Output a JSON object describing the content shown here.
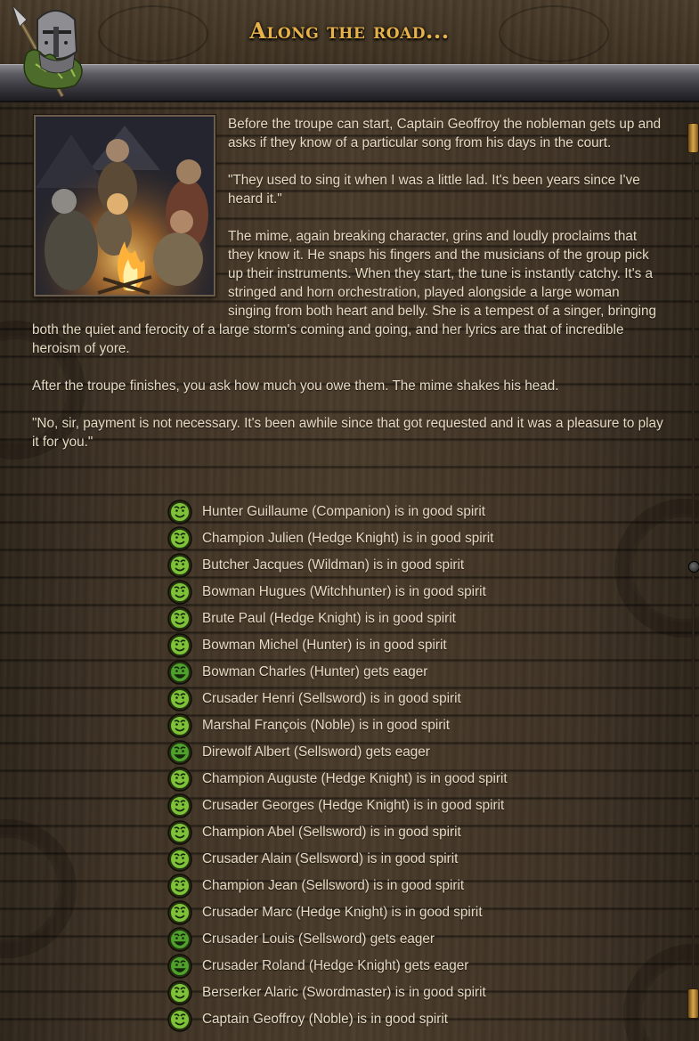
{
  "event": {
    "title": "Along the road...",
    "image_icon": "campfire-troupe-illustration",
    "header_icon": "helmet-spear-icon"
  },
  "story": {
    "paragraphs": [
      "Before the troupe can start, Captain Geoffroy the nobleman gets up and asks if they know of a particular song from his days in the court.",
      "\"They used to sing it when I was a little lad. It's been years since I've heard it.\"",
      "The mime, again breaking character, grins and loudly proclaims that they know it. He snaps his fingers and the musicians of the group pick up their instruments. When they start, the tune is instantly catchy. It's a stringed and horn orchestration, played alongside a large woman singing from both heart and belly. She is a tempest of a singer, bringing both the quiet and ferocity of a large storm's coming and going, and her lyrics are that of incredible heroism of yore.",
      "After the troupe finishes, you ask how much you owe them. The mime shakes his head.",
      "\"No, sir, payment is not necessary. It's been awhile since that got requested and it was a pleasure to play it for you.\""
    ]
  },
  "results": [
    {
      "text": "Hunter Guillaume (Companion) is in good spirit",
      "icon": "mood-good-icon"
    },
    {
      "text": "Champion Julien (Hedge Knight) is in good spirit",
      "icon": "mood-good-icon"
    },
    {
      "text": "Butcher Jacques (Wildman) is in good spirit",
      "icon": "mood-good-icon"
    },
    {
      "text": "Bowman Hugues (Witchhunter) is in good spirit",
      "icon": "mood-good-icon"
    },
    {
      "text": "Brute Paul (Hedge Knight) is in good spirit",
      "icon": "mood-good-icon"
    },
    {
      "text": "Bowman Michel (Hunter) is in good spirit",
      "icon": "mood-good-icon"
    },
    {
      "text": "Bowman Charles (Hunter) gets eager",
      "icon": "mood-eager-icon"
    },
    {
      "text": "Crusader Henri (Sellsword) is in good spirit",
      "icon": "mood-good-icon"
    },
    {
      "text": "Marshal François (Noble) is in good spirit",
      "icon": "mood-good-icon"
    },
    {
      "text": "Direwolf Albert (Sellsword) gets eager",
      "icon": "mood-eager-icon"
    },
    {
      "text": "Champion Auguste (Hedge Knight) is in good spirit",
      "icon": "mood-good-icon"
    },
    {
      "text": "Crusader Georges (Hedge Knight) is in good spirit",
      "icon": "mood-good-icon"
    },
    {
      "text": "Champion Abel (Sellsword) is in good spirit",
      "icon": "mood-good-icon"
    },
    {
      "text": "Crusader Alain (Sellsword) is in good spirit",
      "icon": "mood-good-icon"
    },
    {
      "text": "Champion Jean (Sellsword) is in good spirit",
      "icon": "mood-good-icon"
    },
    {
      "text": "Crusader Marc (Hedge Knight) is in good spirit",
      "icon": "mood-good-icon"
    },
    {
      "text": "Crusader Louis (Sellsword) gets eager",
      "icon": "mood-eager-icon"
    },
    {
      "text": "Crusader Roland (Hedge Knight) gets eager",
      "icon": "mood-eager-icon"
    },
    {
      "text": "Berserker Alaric (Swordmaster) is in good spirit",
      "icon": "mood-good-icon"
    },
    {
      "text": "Captain Geoffroy (Noble) is in good spirit",
      "icon": "mood-good-icon"
    }
  ],
  "colors": {
    "title": "#e8b24a",
    "text": "#e6dac3",
    "mood_good": "#7fc23a",
    "mood_eager": "#4fa02c"
  }
}
